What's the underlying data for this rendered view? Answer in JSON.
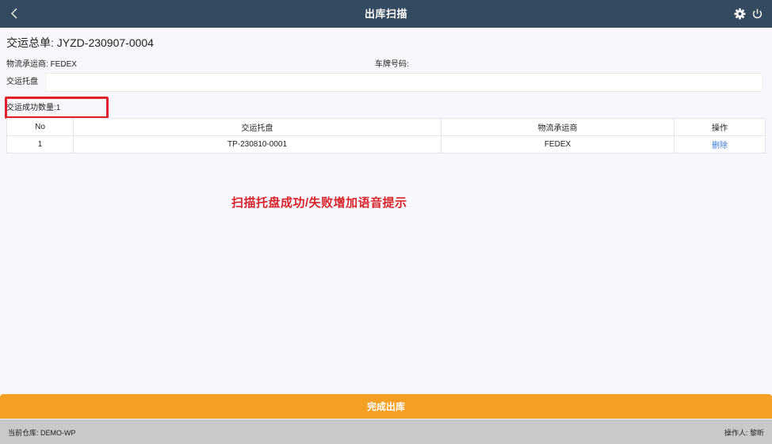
{
  "header": {
    "title": "出库扫描",
    "back_icon": "chevron-left-icon",
    "settings_icon": "gear-icon",
    "power_icon": "power-icon"
  },
  "form": {
    "order_label": "交运总单:",
    "order_value": "JYZD-230907-0004",
    "carrier_label": "物流承运商:",
    "carrier_value": "FEDEX",
    "plate_label": "车牌号码:",
    "plate_value": "",
    "pallet_label": "交运托盘",
    "pallet_input_value": ""
  },
  "success": {
    "label": "交运成功数量:",
    "count": "1"
  },
  "table": {
    "headers": [
      "No",
      "交运托盘",
      "物流承运商",
      "操作"
    ],
    "rows": [
      {
        "no": "1",
        "pallet": "TP-230810-0001",
        "carrier": "FEDEX",
        "action": "删除"
      }
    ]
  },
  "annotation": "扫描托盘成功/失败增加语音提示",
  "finish_button": "完成出库",
  "footer": {
    "warehouse_label": "当前仓库:",
    "warehouse_value": "DEMO-WP",
    "operator_label": "操作人:",
    "operator_value": "黎昕"
  },
  "colors": {
    "header_bg": "#344a5f",
    "accent_orange": "#f5a023",
    "annotation_red": "#d8232a",
    "link_blue": "#3b7ad8",
    "footer_bg": "#c9c9c9"
  }
}
